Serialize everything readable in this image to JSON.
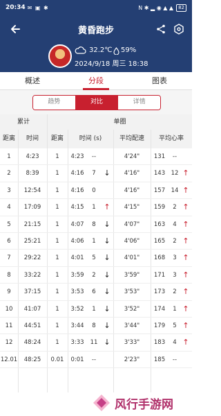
{
  "status_bar": {
    "time": "20:34",
    "left_icons": "✉ ▣ ✱",
    "right_icons": "N ✱ ▂ ◉ ▲ ▲",
    "battery": "82"
  },
  "nav": {
    "title": "黄昏跑步"
  },
  "header": {
    "temperature": "32.2℃",
    "humidity": "59%",
    "datetime": "2024/9/18 周三 18:38"
  },
  "tabs": [
    {
      "label": "概述"
    },
    {
      "label": "分段"
    },
    {
      "label": "图表"
    }
  ],
  "segments": [
    {
      "label": "趋势"
    },
    {
      "label": "对比"
    },
    {
      "label": "详情"
    }
  ],
  "table": {
    "group_cumulative": "累计",
    "group_single": "单圈",
    "columns": [
      "距离",
      "时间",
      "距离",
      "时间 (s)",
      "平均配速",
      "平均心率"
    ],
    "rows": [
      {
        "c_dist": "1",
        "c_time": "4:23",
        "dist": "1",
        "time": "4:23",
        "diff": "--",
        "pace_dir": "",
        "pace": "4'24\"",
        "hr": "131",
        "hr_diff": "--",
        "hr_dir": ""
      },
      {
        "c_dist": "2",
        "c_time": "8:39",
        "dist": "1",
        "time": "4:16",
        "diff": "7",
        "pace_dir": "down",
        "pace": "4'16\"",
        "hr": "143",
        "hr_diff": "12",
        "hr_dir": "up"
      },
      {
        "c_dist": "3",
        "c_time": "12:54",
        "dist": "1",
        "time": "4:16",
        "diff": "0",
        "pace_dir": "",
        "pace": "4'16\"",
        "hr": "157",
        "hr_diff": "14",
        "hr_dir": "up"
      },
      {
        "c_dist": "4",
        "c_time": "17:09",
        "dist": "1",
        "time": "4:15",
        "diff": "1",
        "pace_dir": "up",
        "pace": "4'15\"",
        "hr": "159",
        "hr_diff": "2",
        "hr_dir": "up"
      },
      {
        "c_dist": "5",
        "c_time": "21:15",
        "dist": "1",
        "time": "4:07",
        "diff": "8",
        "pace_dir": "down",
        "pace": "4'07\"",
        "hr": "163",
        "hr_diff": "4",
        "hr_dir": "up"
      },
      {
        "c_dist": "6",
        "c_time": "25:21",
        "dist": "1",
        "time": "4:06",
        "diff": "1",
        "pace_dir": "down",
        "pace": "4'06\"",
        "hr": "165",
        "hr_diff": "2",
        "hr_dir": "up"
      },
      {
        "c_dist": "7",
        "c_time": "29:22",
        "dist": "1",
        "time": "4:01",
        "diff": "5",
        "pace_dir": "down",
        "pace": "4'01\"",
        "hr": "168",
        "hr_diff": "3",
        "hr_dir": "up"
      },
      {
        "c_dist": "8",
        "c_time": "33:22",
        "dist": "1",
        "time": "3:59",
        "diff": "2",
        "pace_dir": "down",
        "pace": "3'59\"",
        "hr": "171",
        "hr_diff": "3",
        "hr_dir": "up"
      },
      {
        "c_dist": "9",
        "c_time": "37:15",
        "dist": "1",
        "time": "3:53",
        "diff": "6",
        "pace_dir": "down",
        "pace": "3'53\"",
        "hr": "173",
        "hr_diff": "2",
        "hr_dir": "up"
      },
      {
        "c_dist": "10",
        "c_time": "41:07",
        "dist": "1",
        "time": "3:52",
        "diff": "1",
        "pace_dir": "down",
        "pace": "3'52\"",
        "hr": "174",
        "hr_diff": "1",
        "hr_dir": "up"
      },
      {
        "c_dist": "11",
        "c_time": "44:51",
        "dist": "1",
        "time": "3:44",
        "diff": "8",
        "pace_dir": "down",
        "pace": "3'44\"",
        "hr": "179",
        "hr_diff": "5",
        "hr_dir": "up"
      },
      {
        "c_dist": "12",
        "c_time": "48:24",
        "dist": "1",
        "time": "3:33",
        "diff": "11",
        "pace_dir": "down",
        "pace": "3'33\"",
        "hr": "183",
        "hr_diff": "4",
        "hr_dir": "up"
      },
      {
        "c_dist": "12.01",
        "c_time": "48:25",
        "dist": "0.01",
        "time": "0:01",
        "diff": "--",
        "pace_dir": "",
        "pace": "2'23\"",
        "hr": "185",
        "hr_diff": "--",
        "hr_dir": ""
      }
    ]
  },
  "watermark": {
    "text": "风行手游网"
  },
  "colors": {
    "header_bg": "#243f73",
    "accent": "#c8202f"
  }
}
